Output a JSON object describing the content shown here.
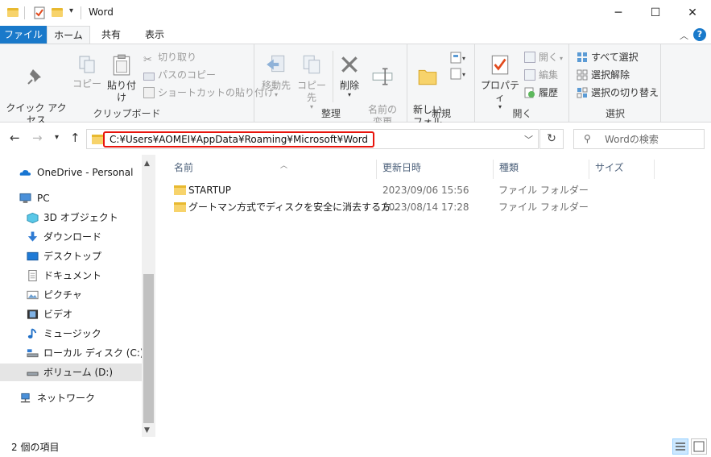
{
  "window": {
    "title": "Word",
    "minimize_glyph": "─",
    "maximize_glyph": "☐",
    "close_glyph": "✕"
  },
  "ribbon_tabs": {
    "file": "ファイル",
    "home": "ホーム",
    "share": "共有",
    "view": "表示",
    "help": "?"
  },
  "clipboard": {
    "pin_quick_access": "クイック アクセス\nにピン留めする",
    "copy": "コピー",
    "paste": "貼り付け",
    "cut": "切り取り",
    "copy_path": "パスのコピー",
    "paste_shortcut": "ショートカットの貼り付け",
    "label": "クリップボード"
  },
  "organize": {
    "move_to": "移動先",
    "copy_to": "コピー先",
    "delete": "削除",
    "rename": "名前の\n変更",
    "label": "整理"
  },
  "new_group": {
    "new_folder": "新しい\nフォルダー",
    "label": "新規"
  },
  "open_group": {
    "properties": "プロパティ",
    "open": "開く",
    "edit": "編集",
    "history": "履歴",
    "label": "開く"
  },
  "select_group": {
    "select_all": "すべて選択",
    "select_none": "選択解除",
    "invert": "選択の切り替え",
    "label": "選択"
  },
  "address": {
    "path": "C:¥Users¥AOMEI¥AppData¥Roaming¥Microsoft¥Word",
    "search_placeholder": "Wordの検索"
  },
  "nav_pane": [
    {
      "label": "OneDrive - Personal",
      "icon": "onedrive-icon"
    },
    {
      "label": "PC",
      "icon": "pc-icon"
    },
    {
      "label": "3D オブジェクト",
      "icon": "3d-objects-icon"
    },
    {
      "label": "ダウンロード",
      "icon": "download-icon"
    },
    {
      "label": "デスクトップ",
      "icon": "desktop-icon"
    },
    {
      "label": "ドキュメント",
      "icon": "documents-icon"
    },
    {
      "label": "ピクチャ",
      "icon": "pictures-icon"
    },
    {
      "label": "ビデオ",
      "icon": "videos-icon"
    },
    {
      "label": "ミュージック",
      "icon": "music-icon"
    },
    {
      "label": "ローカル ディスク (C:)",
      "icon": "local-disk-icon"
    },
    {
      "label": "ボリューム (D:)",
      "icon": "volume-icon"
    },
    {
      "label": "ネットワーク",
      "icon": "network-icon"
    }
  ],
  "columns": {
    "name": "名前",
    "modified": "更新日時",
    "type": "種類",
    "size": "サイズ"
  },
  "files": [
    {
      "name": "STARTUP",
      "modified": "2023/09/06 15:56",
      "type": "ファイル フォルダー"
    },
    {
      "name": "グートマン方式でディスクを安全に消去する方...",
      "modified": "2023/08/14 17:28",
      "type": "ファイル フォルダー"
    }
  ],
  "status": {
    "item_count": "2 個の項目"
  },
  "colors": {
    "accent": "#1979ca",
    "address_highlight": "#e8140c",
    "folder": "#f7d36b"
  }
}
